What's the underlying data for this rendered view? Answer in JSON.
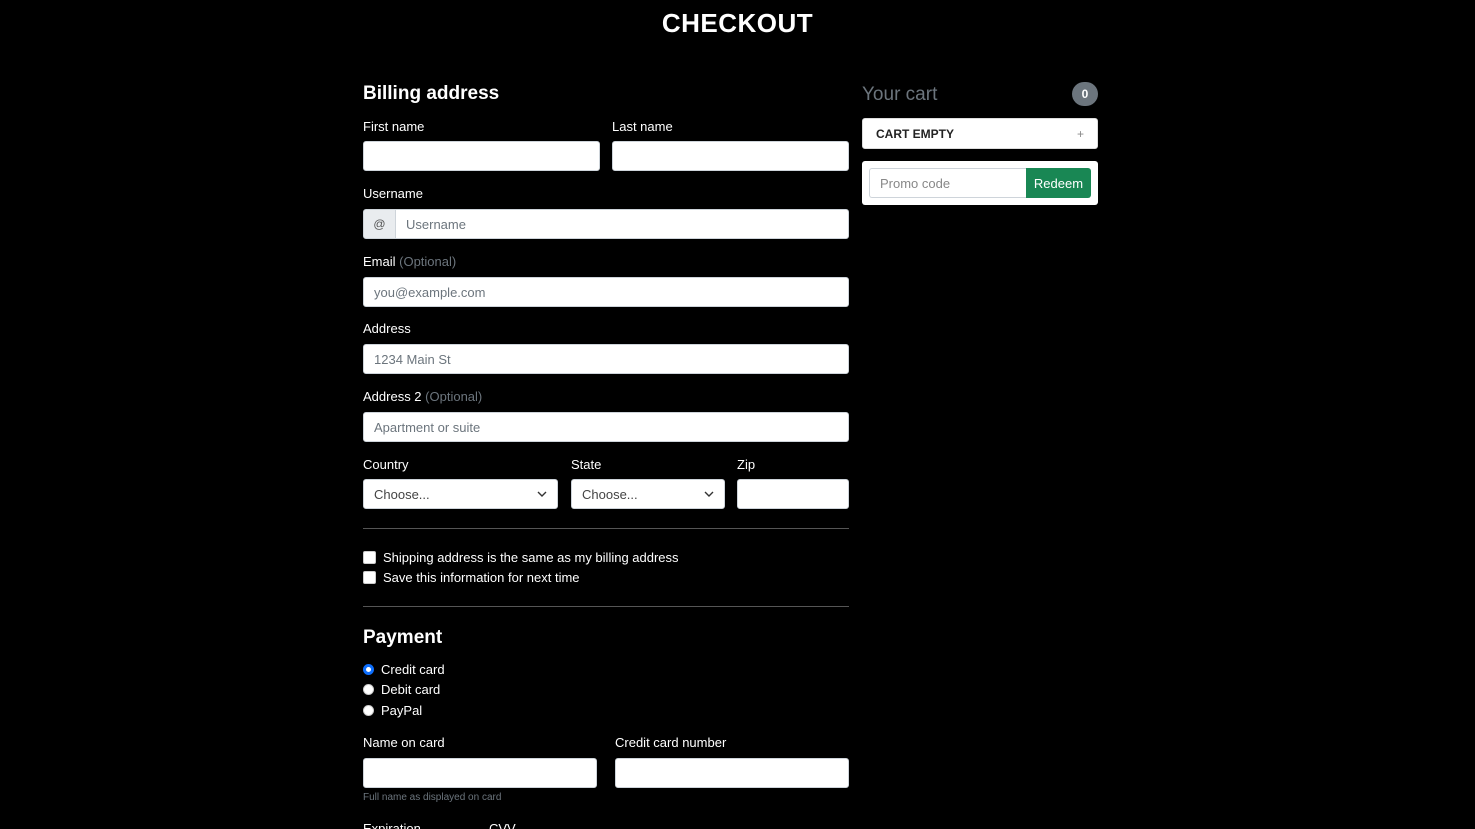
{
  "page": {
    "title": "CHECKOUT"
  },
  "billing": {
    "heading": "Billing address",
    "first_name": {
      "label": "First name",
      "value": ""
    },
    "last_name": {
      "label": "Last name",
      "value": ""
    },
    "username": {
      "label": "Username",
      "prefix": "@",
      "placeholder": "Username"
    },
    "email": {
      "label": "Email",
      "optional": "(Optional)",
      "placeholder": "you@example.com"
    },
    "address": {
      "label": "Address",
      "placeholder": "1234 Main St"
    },
    "address2": {
      "label": "Address 2",
      "optional": "(Optional)",
      "placeholder": "Apartment or suite"
    },
    "country": {
      "label": "Country",
      "selected": "Choose..."
    },
    "state": {
      "label": "State",
      "selected": "Choose..."
    },
    "zip": {
      "label": "Zip",
      "value": ""
    }
  },
  "options": {
    "same_address": "Shipping address is the same as my billing address",
    "save_info": "Save this information for next time"
  },
  "payment": {
    "heading": "Payment",
    "methods": [
      {
        "label": "Credit card",
        "checked": true
      },
      {
        "label": "Debit card",
        "checked": false
      },
      {
        "label": "PayPal",
        "checked": false
      }
    ],
    "name_on_card": {
      "label": "Name on card",
      "help": "Full name as displayed on card"
    },
    "card_number": {
      "label": "Credit card number"
    },
    "expiration": {
      "label": "Expiration"
    },
    "cvv": {
      "label": "CVV"
    }
  },
  "cart": {
    "heading": "Your cart",
    "count": "0",
    "item": "CART EMPTY",
    "item_action": "+",
    "promo_placeholder": "Promo code",
    "redeem_label": "Redeem"
  },
  "colors": {
    "background": "#000000",
    "accent_radio": "#0d6efd",
    "redeem_button": "#198754",
    "badge": "#6c757d"
  }
}
